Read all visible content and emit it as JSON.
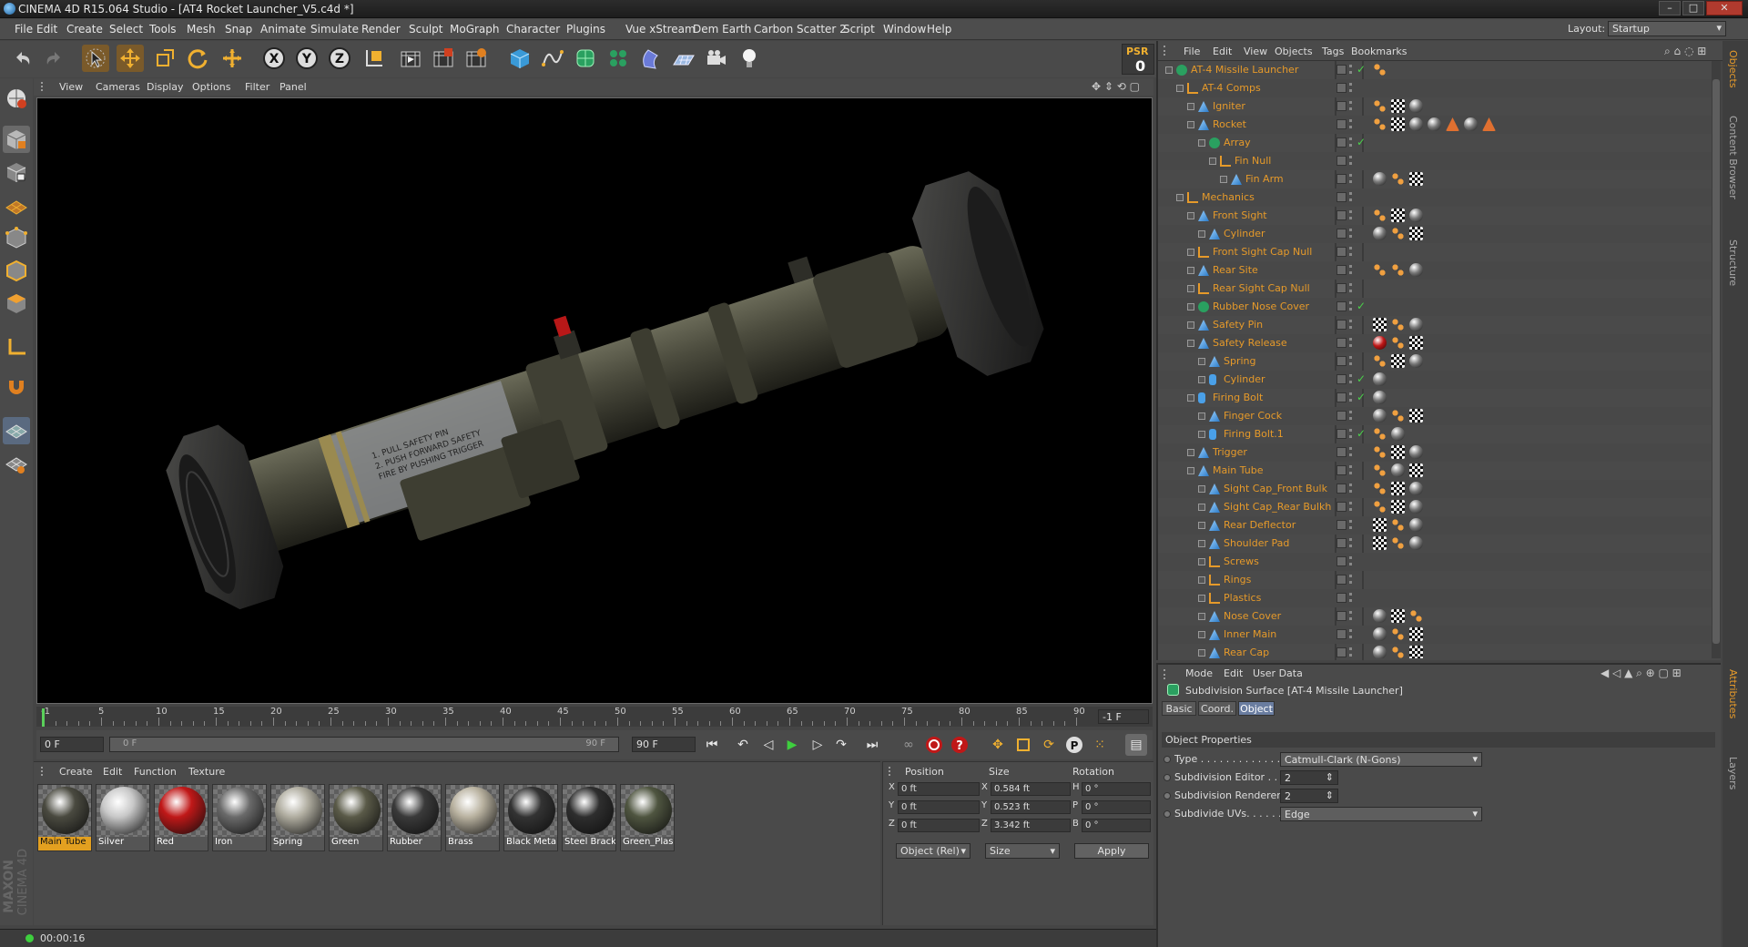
{
  "window": {
    "title": "CINEMA 4D R15.064 Studio - [AT4 Rocket Launcher_V5.c4d *]"
  },
  "menu": [
    "File",
    "Edit",
    "Create",
    "Select",
    "Tools",
    "Mesh",
    "Snap",
    "Animate",
    "Simulate",
    "Render",
    "Sculpt",
    "MoGraph",
    "Character",
    "Plugins",
    "Vue xStream",
    "Dem Earth",
    "Carbon Scatter 2",
    "Script",
    "Window",
    "Help"
  ],
  "layout": {
    "label": "Layout:",
    "value": "Startup"
  },
  "psr": {
    "label": "PSR",
    "value": "0"
  },
  "viewport_menu": [
    "View",
    "Cameras",
    "Display",
    "Options",
    "Filter",
    "Panel"
  ],
  "timeline": {
    "ticks": [
      "-1",
      "5",
      "10",
      "15",
      "20",
      "25",
      "30",
      "35",
      "40",
      "45",
      "50",
      "55",
      "60",
      "65",
      "70",
      "75",
      "80",
      "85",
      "90"
    ],
    "end_frame": "-1 F",
    "start_field": "0 F",
    "range_start": "0 F",
    "range_end": "90 F",
    "end_field": "90 F"
  },
  "materials": {
    "menu": [
      "Create",
      "Edit",
      "Function",
      "Texture"
    ],
    "items": [
      {
        "name": "Main Tube",
        "color": "#4a4a40",
        "selected": true
      },
      {
        "name": "Silver",
        "color": "#c8c8c8"
      },
      {
        "name": "Red",
        "color": "#c01818"
      },
      {
        "name": "Iron",
        "color": "#6a6a6a"
      },
      {
        "name": "Spring",
        "color": "#b0ada0"
      },
      {
        "name": "Green",
        "color": "#5a5a48"
      },
      {
        "name": "Rubber",
        "color": "#3a3a3a"
      },
      {
        "name": "Brass",
        "color": "#b9b2a0"
      },
      {
        "name": "Black Meta",
        "color": "#333333"
      },
      {
        "name": "Steel Brack",
        "color": "#2e2e2e"
      },
      {
        "name": "Green_Plas",
        "color": "#4f5540"
      }
    ]
  },
  "coords": {
    "headers": [
      "Position",
      "Size",
      "Rotation"
    ],
    "rows": [
      {
        "axis": "X",
        "pos": "0 ft",
        "saxis": "X",
        "size": "0.584 ft",
        "raxis": "H",
        "rot": "0 °"
      },
      {
        "axis": "Y",
        "pos": "0 ft",
        "saxis": "Y",
        "size": "0.523 ft",
        "raxis": "P",
        "rot": "0 °"
      },
      {
        "axis": "Z",
        "pos": "0 ft",
        "saxis": "Z",
        "size": "3.342 ft",
        "raxis": "B",
        "rot": "0 °"
      }
    ],
    "mode": "Object (Rel)",
    "size_mode": "Size",
    "apply": "Apply"
  },
  "status": {
    "time": "00:00:16"
  },
  "objects": {
    "menu": [
      "File",
      "Edit",
      "View",
      "Objects",
      "Tags",
      "Bookmarks"
    ],
    "rows": [
      {
        "name": "AT-4 Missile Launcher",
        "depth": 0,
        "icon": "subdiv",
        "check": true
      },
      {
        "name": "AT-4 Comps",
        "depth": 1,
        "icon": "null"
      },
      {
        "name": "Igniter",
        "depth": 2,
        "icon": "poly"
      },
      {
        "name": "Rocket",
        "depth": 2,
        "icon": "poly"
      },
      {
        "name": "Array",
        "depth": 3,
        "icon": "array",
        "check": true
      },
      {
        "name": "Fin Null",
        "depth": 4,
        "icon": "null"
      },
      {
        "name": "Fin Arm",
        "depth": 5,
        "icon": "poly"
      },
      {
        "name": "Mechanics",
        "depth": 1,
        "icon": "null"
      },
      {
        "name": "Front Sight",
        "depth": 2,
        "icon": "poly"
      },
      {
        "name": "Cylinder",
        "depth": 3,
        "icon": "poly"
      },
      {
        "name": "Front Sight Cap Null",
        "depth": 2,
        "icon": "null"
      },
      {
        "name": "Rear Site",
        "depth": 2,
        "icon": "poly"
      },
      {
        "name": "Rear Sight Cap Null",
        "depth": 2,
        "icon": "null"
      },
      {
        "name": "Rubber Nose Cover",
        "depth": 2,
        "icon": "array",
        "check": true
      },
      {
        "name": "Safety Pin",
        "depth": 2,
        "icon": "poly"
      },
      {
        "name": "Safety Release",
        "depth": 2,
        "icon": "poly"
      },
      {
        "name": "Spring",
        "depth": 3,
        "icon": "poly"
      },
      {
        "name": "Cylinder",
        "depth": 3,
        "icon": "cyl",
        "check": true
      },
      {
        "name": "Firing Bolt",
        "depth": 2,
        "icon": "cyl",
        "check": true
      },
      {
        "name": "Finger Cock",
        "depth": 3,
        "icon": "poly"
      },
      {
        "name": "Firing Bolt.1",
        "depth": 3,
        "icon": "cyl",
        "check": true
      },
      {
        "name": "Trigger",
        "depth": 2,
        "icon": "poly"
      },
      {
        "name": "Main Tube",
        "depth": 2,
        "icon": "poly"
      },
      {
        "name": "Sight Cap_Front Bulk",
        "depth": 3,
        "icon": "poly"
      },
      {
        "name": "Sight Cap_Rear Bulkh",
        "depth": 3,
        "icon": "poly"
      },
      {
        "name": "Rear Deflector",
        "depth": 3,
        "icon": "poly"
      },
      {
        "name": "Shoulder Pad",
        "depth": 3,
        "icon": "poly"
      },
      {
        "name": "Screws",
        "depth": 3,
        "icon": "null"
      },
      {
        "name": "Rings",
        "depth": 3,
        "icon": "null"
      },
      {
        "name": "Plastics",
        "depth": 3,
        "icon": "null"
      },
      {
        "name": "Nose Cover",
        "depth": 3,
        "icon": "poly"
      },
      {
        "name": "Inner Main",
        "depth": 3,
        "icon": "poly"
      },
      {
        "name": "Rear Cap",
        "depth": 3,
        "icon": "poly"
      }
    ]
  },
  "attributes": {
    "menu": [
      "Mode",
      "Edit",
      "User Data"
    ],
    "title": "Subdivision Surface [AT-4 Missile Launcher]",
    "tabs": [
      "Basic",
      "Coord.",
      "Object"
    ],
    "active_tab": "Object",
    "section": "Object Properties",
    "props": [
      {
        "label": "Type . . . . . . . . . . . . . .",
        "value": "Catmull-Clark (N-Gons)",
        "kind": "dropdown"
      },
      {
        "label": "Subdivision Editor . .",
        "value": "2",
        "kind": "number"
      },
      {
        "label": "Subdivision Renderer",
        "value": "2",
        "kind": "number"
      },
      {
        "label": "Subdivide UVs. . . . . .",
        "value": "Edge",
        "kind": "dropdown"
      }
    ]
  },
  "side_tabs": {
    "top": [
      "Objects",
      "Content Browser",
      "Structure"
    ],
    "bottom": [
      "Attributes",
      "Layers"
    ]
  },
  "brand": {
    "maxon": "MAXON",
    "product": "CINEMA 4D"
  },
  "label_text": {
    "line1": "1. PULL SAFETY PIN",
    "line2": "2. PUSH FORWARD SAFETY",
    "line3": "FIRE BY PUSHING TRIGGER"
  }
}
